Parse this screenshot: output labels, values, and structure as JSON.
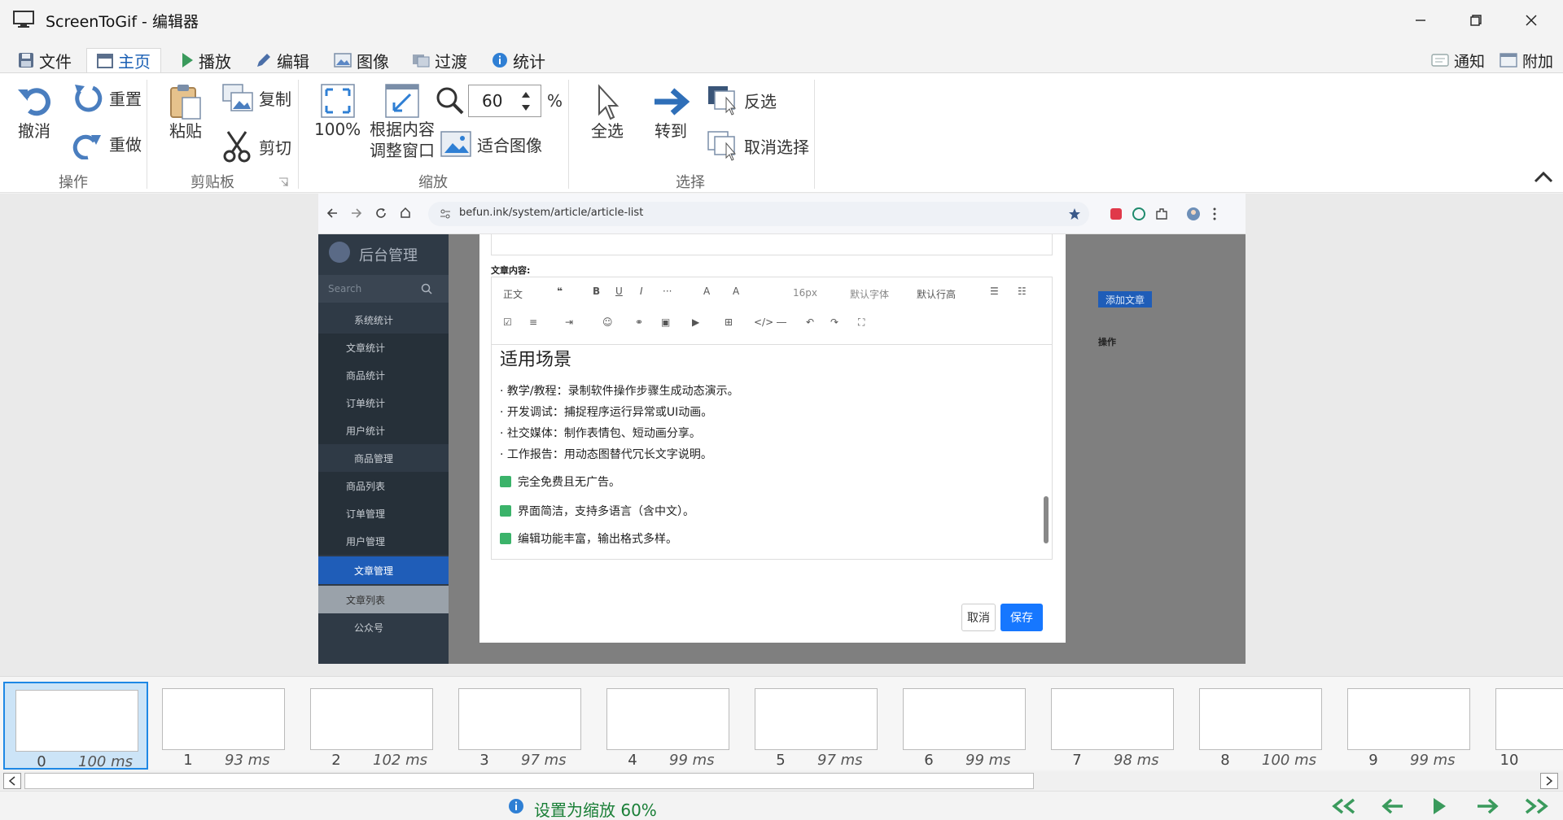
{
  "window": {
    "title": "ScreenToGif - 编辑器"
  },
  "tabs": [
    {
      "label": "文件"
    },
    {
      "label": "主页"
    },
    {
      "label": "播放"
    },
    {
      "label": "编辑"
    },
    {
      "label": "图像"
    },
    {
      "label": "过渡"
    },
    {
      "label": "统计"
    }
  ],
  "topright": {
    "notify": "通知",
    "extras": "附加"
  },
  "ribbon": {
    "undo": "撤消",
    "reset": "重置",
    "redo": "重做",
    "group_action": "操作",
    "paste": "粘贴",
    "copy": "复制",
    "cut": "剪切",
    "group_clipboard": "剪贴板",
    "zoom100": "100%",
    "fit_content_1": "根据内容",
    "fit_content_2": "调整窗口",
    "zoom_value": "60",
    "zoom_unit": "%",
    "fit_image": "适合图像",
    "group_zoom": "缩放",
    "select_all": "全选",
    "goto": "转到",
    "invert": "反选",
    "deselect": "取消选择",
    "group_select": "选择"
  },
  "browser": {
    "url": "befun.ink/system/article/article-list"
  },
  "admin": {
    "brand": "后台管理",
    "search_placeholder": "Search",
    "menu": [
      "系统统计",
      "文章统计",
      "商品统计",
      "订单统计",
      "用户统计",
      "商品管理",
      "商品列表",
      "订单管理",
      "用户管理",
      "文章管理",
      "文章列表",
      "公众号"
    ],
    "add_button": "添加文章",
    "col_ops": "操作"
  },
  "editor": {
    "field_label": "文章内容:",
    "toolbar": {
      "para": "正文",
      "size": "16px",
      "font": "默认字体",
      "line": "默认行高"
    },
    "heading": "适用场景",
    "bullets": [
      "· 教学/教程：录制软件操作步骤生成动态演示。",
      "· 开发调试：捕捉程序运行异常或UI动画。",
      "· 社交媒体：制作表情包、短动画分享。",
      "· 工作报告：用动态图替代冗长文字说明。"
    ],
    "checks": [
      "完全免费且无广告。",
      "界面简洁，支持多语言（含中文）。",
      "编辑功能丰富，输出格式多样。"
    ],
    "cancel": "取消",
    "save": "保存"
  },
  "frames": [
    {
      "num": "0",
      "ms": "100 ms"
    },
    {
      "num": "1",
      "ms": "93 ms"
    },
    {
      "num": "2",
      "ms": "102 ms"
    },
    {
      "num": "3",
      "ms": "97 ms"
    },
    {
      "num": "4",
      "ms": "99 ms"
    },
    {
      "num": "5",
      "ms": "97 ms"
    },
    {
      "num": "6",
      "ms": "99 ms"
    },
    {
      "num": "7",
      "ms": "98 ms"
    },
    {
      "num": "8",
      "ms": "100 ms"
    },
    {
      "num": "9",
      "ms": "99 ms"
    },
    {
      "num": "10",
      "ms": ""
    }
  ],
  "status": {
    "message": "设置为缩放 60%"
  },
  "colors": {
    "accent": "#1e88e5",
    "status_green": "#1a7f37",
    "ribbon_bg": "#ffffff"
  }
}
